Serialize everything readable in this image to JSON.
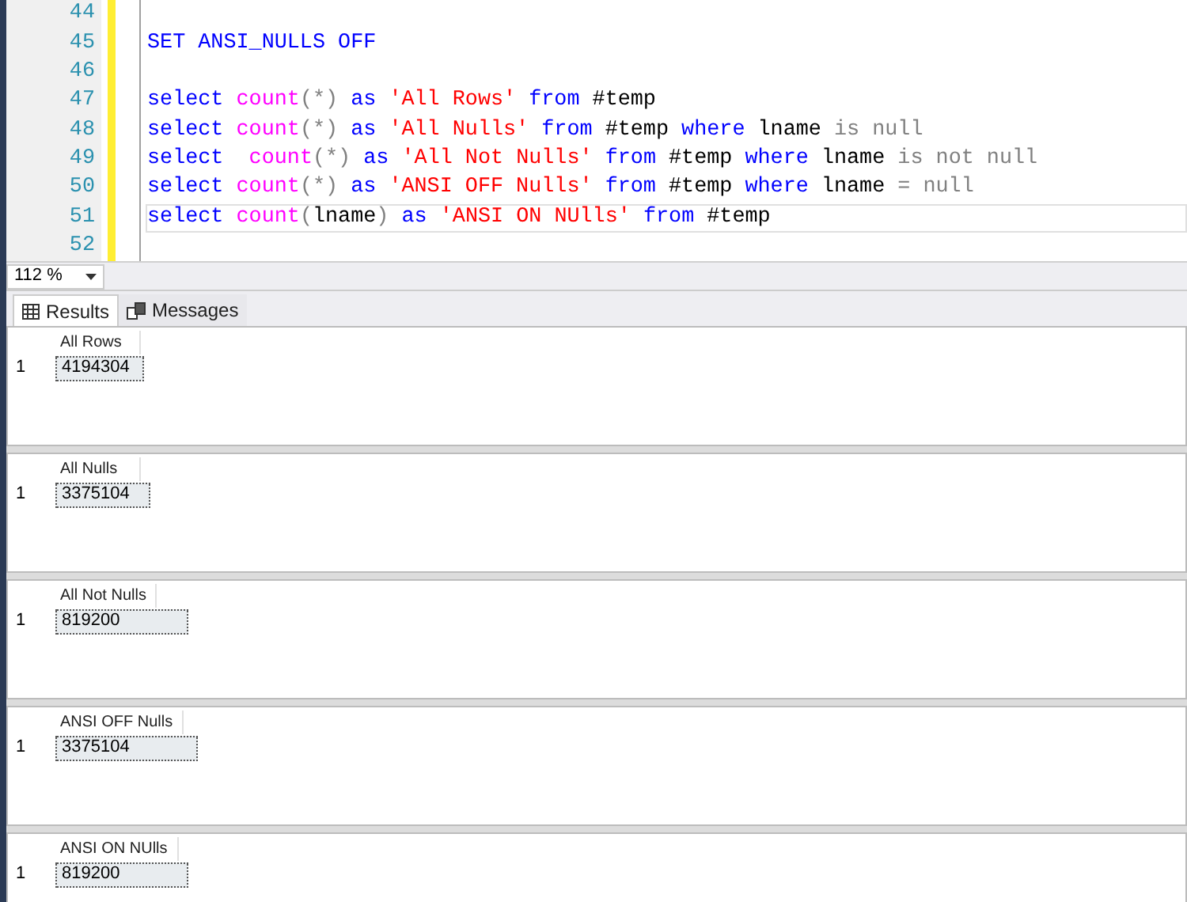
{
  "editor": {
    "lines": [
      {
        "number": "44",
        "current": false
      },
      {
        "number": "45",
        "current": false,
        "tokens": [
          {
            "kind": "keyword",
            "text": "SET ANSI_NULLS OFF"
          }
        ]
      },
      {
        "number": "46",
        "current": false
      },
      {
        "number": "47",
        "current": false,
        "tokens": [
          {
            "kind": "keyword",
            "text": "select "
          },
          {
            "kind": "function",
            "text": "count"
          },
          {
            "kind": "operator",
            "text": "(*)"
          },
          {
            "kind": "keyword",
            "text": " as "
          },
          {
            "kind": "string",
            "text": "'All Rows'"
          },
          {
            "kind": "keyword",
            "text": " from "
          },
          {
            "kind": "plain",
            "text": "#temp"
          }
        ]
      },
      {
        "number": "48",
        "current": false,
        "tokens": [
          {
            "kind": "keyword",
            "text": "select "
          },
          {
            "kind": "function",
            "text": "count"
          },
          {
            "kind": "operator",
            "text": "(*)"
          },
          {
            "kind": "keyword",
            "text": " as "
          },
          {
            "kind": "string",
            "text": "'All Nulls'"
          },
          {
            "kind": "keyword",
            "text": " from "
          },
          {
            "kind": "plain",
            "text": "#temp "
          },
          {
            "kind": "keyword",
            "text": "where "
          },
          {
            "kind": "plain",
            "text": "lname "
          },
          {
            "kind": "operator",
            "text": "is null"
          }
        ]
      },
      {
        "number": "49",
        "current": false,
        "tokens": [
          {
            "kind": "keyword",
            "text": "select  "
          },
          {
            "kind": "function",
            "text": "count"
          },
          {
            "kind": "operator",
            "text": "(*)"
          },
          {
            "kind": "keyword",
            "text": " as "
          },
          {
            "kind": "string",
            "text": "'All Not Nulls'"
          },
          {
            "kind": "keyword",
            "text": " from "
          },
          {
            "kind": "plain",
            "text": "#temp "
          },
          {
            "kind": "keyword",
            "text": "where "
          },
          {
            "kind": "plain",
            "text": "lname "
          },
          {
            "kind": "operator",
            "text": "is not null"
          }
        ]
      },
      {
        "number": "50",
        "current": false,
        "tokens": [
          {
            "kind": "keyword",
            "text": "select "
          },
          {
            "kind": "function",
            "text": "count"
          },
          {
            "kind": "operator",
            "text": "(*)"
          },
          {
            "kind": "keyword",
            "text": " as "
          },
          {
            "kind": "string",
            "text": "'ANSI OFF Nulls'"
          },
          {
            "kind": "keyword",
            "text": " from "
          },
          {
            "kind": "plain",
            "text": "#temp "
          },
          {
            "kind": "keyword",
            "text": "where "
          },
          {
            "kind": "plain",
            "text": "lname "
          },
          {
            "kind": "operator",
            "text": "= null"
          }
        ]
      },
      {
        "number": "51",
        "current": true,
        "tokens": [
          {
            "kind": "keyword",
            "text": "select "
          },
          {
            "kind": "function",
            "text": "count"
          },
          {
            "kind": "operator",
            "text": "("
          },
          {
            "kind": "plain",
            "text": "lname"
          },
          {
            "kind": "operator",
            "text": ")"
          },
          {
            "kind": "keyword",
            "text": " as "
          },
          {
            "kind": "string",
            "text": "'ANSI ON NUlls'"
          },
          {
            "kind": "keyword",
            "text": " from "
          },
          {
            "kind": "plain",
            "text": "#temp"
          }
        ]
      },
      {
        "number": "52",
        "current": false
      }
    ]
  },
  "zoom": {
    "value": "112 %"
  },
  "tabs": [
    {
      "label": "Results",
      "selected": true
    },
    {
      "label": "Messages",
      "selected": false
    }
  ],
  "results": [
    {
      "column": "All Rows",
      "rows": [
        {
          "number": "1",
          "value": "4194304"
        }
      ]
    },
    {
      "column": "All Nulls",
      "rows": [
        {
          "number": "1",
          "value": "3375104"
        }
      ]
    },
    {
      "column": "All Not Nulls",
      "rows": [
        {
          "number": "1",
          "value": "819200"
        }
      ]
    },
    {
      "column": "ANSI OFF Nulls",
      "rows": [
        {
          "number": "1",
          "value": "3375104"
        }
      ]
    },
    {
      "column": "ANSI ON NUlls",
      "rows": [
        {
          "number": "1",
          "value": "819200"
        }
      ]
    }
  ]
}
